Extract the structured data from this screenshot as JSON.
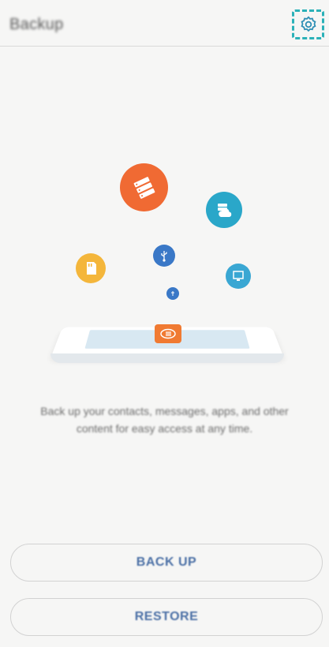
{
  "header": {
    "title": "Backup",
    "settings_icon": "gear-icon",
    "highlight_color": "#2bb1b8"
  },
  "illustration": {
    "icons": [
      {
        "name": "server-icon",
        "color": "#f06a33"
      },
      {
        "name": "cloud-icon",
        "color": "#2aa7c9"
      },
      {
        "name": "sd-card-icon",
        "color": "#f4b63b"
      },
      {
        "name": "usb-icon",
        "color": "#3a78c7"
      },
      {
        "name": "computer-icon",
        "color": "#3aa7d3"
      },
      {
        "name": "small-dot-icon",
        "color": "#3a78c7"
      },
      {
        "name": "backup-app-icon",
        "color": "#f07a32"
      }
    ]
  },
  "description": "Back up your contacts, messages, apps, and other content for easy access at any time.",
  "buttons": {
    "backup_label": "BACK UP",
    "restore_label": "RESTORE",
    "text_color": "#4a6fa5"
  }
}
